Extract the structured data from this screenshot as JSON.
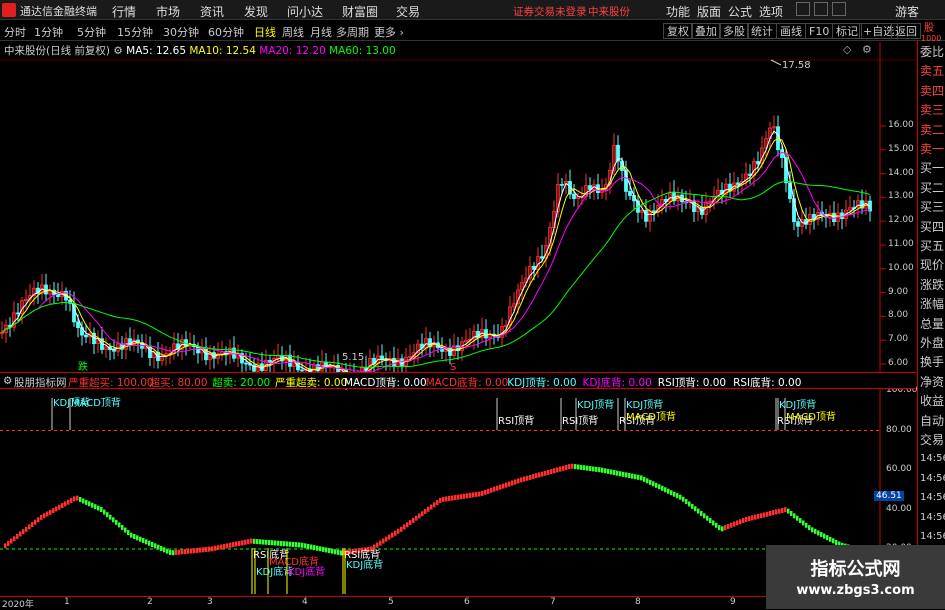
{
  "app_title": "通达信金融终端",
  "menu": [
    "行情",
    "市场",
    "资讯",
    "发现",
    "问小达",
    "财富圈",
    "交易"
  ],
  "notice": "证券交易未登录",
  "notice_stock": "中来股份",
  "right_menu": [
    "功能",
    "版面",
    "公式",
    "选项"
  ],
  "user": "游客",
  "periods": [
    "分时",
    "1分钟",
    "5分钟",
    "15分钟",
    "30分钟",
    "60分钟",
    "日线",
    "周线",
    "月线",
    "多周期",
    "更多 ›"
  ],
  "selected_period": "日线",
  "toolbar": [
    "复权",
    "叠加",
    "多股",
    "统计",
    "画线",
    "F10",
    "标记",
    "+自选",
    "返回"
  ],
  "stock_title": "中来股份(日线 前复权)",
  "ma": {
    "ma5": "MA5: 12.65",
    "ma10": "MA10: 12.54",
    "ma20": "MA20: 12.20",
    "ma60": "MA60: 13.00"
  },
  "colors": {
    "ma5": "#ffffff",
    "ma10": "#ffff00",
    "ma20": "#ff00ff",
    "ma60": "#00ff00",
    "up": "#ff3030",
    "down": "#54ffff",
    "accent": "#ff3030"
  },
  "price_axis": [
    "16.00",
    "15.00",
    "14.00",
    "13.00",
    "12.00",
    "11.00",
    "10.00",
    "9.00",
    "8.00",
    "7.00",
    "6.00"
  ],
  "annotations": {
    "high": "17.58",
    "low": "5.15",
    "buy_marks": [
      "跌",
      "S"
    ]
  },
  "indicator": {
    "name": "股朋指标网",
    "labels": [
      {
        "text": "严重超买: 100.00",
        "color": "#ff3030"
      },
      {
        "text": "超买: 80.00",
        "color": "#ff3030"
      },
      {
        "text": "超卖: 20.00",
        "color": "#00ff00"
      },
      {
        "text": "严重超卖: 0.00",
        "color": "#ffff00"
      },
      {
        "text": "MACD顶背: 0.00",
        "color": "#ffffff"
      },
      {
        "text": "MACD底背: 0.00",
        "color": "#ff3030"
      },
      {
        "text": "KDJ顶背: 0.00",
        "color": "#54ffff"
      },
      {
        "text": "KDJ底背: 0.00",
        "color": "#ff00ff"
      },
      {
        "text": "RSI顶背: 0.00",
        "color": "#ffffff"
      },
      {
        "text": "RSI底背: 0.00",
        "color": "#ffffff"
      }
    ],
    "axis": [
      "100.00",
      "80.00",
      "60.00",
      "40.00",
      "20.00"
    ],
    "current": "46.51",
    "signals_top": [
      "KDJ顶背",
      "MACD顶背",
      "RSI顶背",
      "RSI顶背",
      "KDJ顶背",
      "RSI顶背",
      "KDJ顶背",
      "MACD顶背",
      "RSI顶背",
      "KDJ顶背",
      "MACD顶背"
    ],
    "signals_bottom": [
      "RSI底背",
      "KDJ底背",
      "MACD底背",
      "KDJ底背",
      "RSI底背",
      "KDJ底背"
    ]
  },
  "sidebar": [
    "委比",
    "卖五",
    "卖四",
    "卖三",
    "卖二",
    "卖一",
    "买一",
    "买二",
    "买三",
    "买四",
    "买五",
    "现价",
    "涨跌",
    "涨幅",
    "总量",
    "外盘",
    "换手",
    "净资",
    "收益",
    "自动",
    "交易",
    "14:56",
    "14:56",
    "14:56",
    "14:56",
    "14:56",
    "14:56",
    "14:56"
  ],
  "sidebar_top": [
    "股",
    "1000"
  ],
  "xaxis": [
    "2020年",
    "1",
    "2",
    "3",
    "4",
    "5",
    "6",
    "7",
    "8",
    "9",
    "1"
  ],
  "watermark": {
    "title": "指标公式网",
    "url": "www.zbgs3.com"
  }
}
